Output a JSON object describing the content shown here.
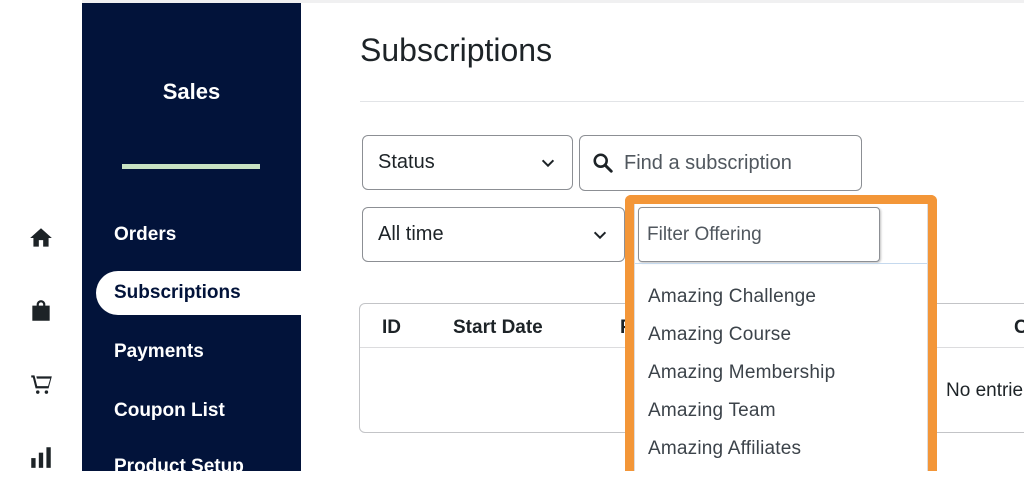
{
  "sidebar": {
    "title": "Sales",
    "items": [
      {
        "label": "Orders"
      },
      {
        "label": "Subscriptions"
      },
      {
        "label": "Payments"
      },
      {
        "label": "Coupon List"
      },
      {
        "label": "Product Setup"
      }
    ]
  },
  "rail": {
    "icons": [
      "home-icon",
      "store-bag-icon",
      "cart-icon",
      "bar-chart-icon"
    ]
  },
  "main": {
    "title": "Subscriptions",
    "filters": {
      "status_value": "Status",
      "search_placeholder": "Find a subscription",
      "time_value": "All time",
      "offering_placeholder": "Filter Offering"
    },
    "table": {
      "headers": [
        "ID",
        "Start Date",
        "P",
        "C"
      ],
      "empty_text": "No entrie"
    },
    "offering_options": [
      "Amazing Challenge",
      "Amazing Course",
      "Amazing Membership",
      "Amazing Team",
      "Amazing Affiliates"
    ]
  },
  "colors": {
    "sidebar_bg": "#02133a",
    "sidebar_accent": "#c8e3c4",
    "highlight": "#f39638"
  }
}
